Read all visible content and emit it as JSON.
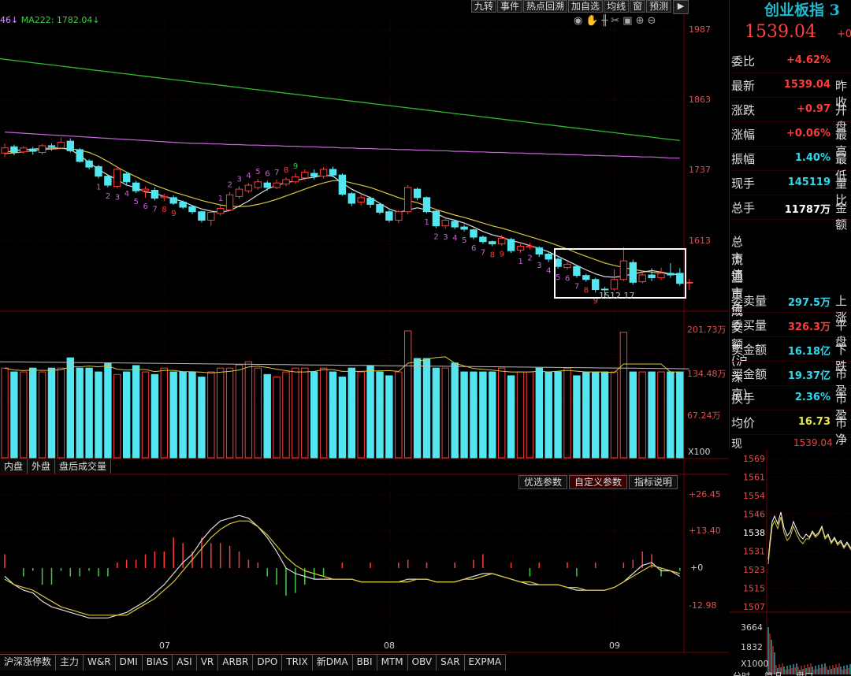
{
  "toolbar": {
    "items": [
      "九转",
      "事件",
      "热点回溯",
      "加自选",
      "均线",
      "窗",
      "预测"
    ]
  },
  "legend": {
    "prefix": "46↓",
    "ma222": "MA222: 1782.04↓"
  },
  "main": {
    "price_ticks": [
      "1987",
      "1863",
      "1737",
      "1613"
    ],
    "box_label": "1512.17",
    "month_labels": [
      "07",
      "08",
      "09"
    ]
  },
  "volume": {
    "ticks": [
      "201.73万",
      "134.48万",
      "67.24万"
    ],
    "unit": "X100",
    "tabs": [
      "内盘",
      "外盘",
      "盘后成交量"
    ]
  },
  "macd": {
    "ticks": [
      "+26.45",
      "+13.40",
      "+0",
      "-12.98"
    ],
    "tabs": [
      "优选参数",
      "自定义参数",
      "指标说明"
    ]
  },
  "bottom_tabs": [
    "沪深涨停数",
    "主力",
    "W&R",
    "DMI",
    "BIAS",
    "ASI",
    "VR",
    "ARBR",
    "DPO",
    "TRIX",
    "新DMA",
    "BBI",
    "MTM",
    "OBV",
    "SAR",
    "EXPMA"
  ],
  "quote": {
    "title": "创业板指 3",
    "price": "1539.04",
    "price_side": "+0",
    "rows": [
      {
        "label": "委比",
        "value": "+4.62%",
        "color": "red",
        "side": ""
      },
      {
        "label": "最新",
        "value": "1539.04",
        "color": "red",
        "side": "昨收"
      },
      {
        "label": "涨跌",
        "value": "+0.97",
        "color": "red",
        "side": "开盘"
      },
      {
        "label": "涨幅",
        "value": "+0.06%",
        "color": "red",
        "side": "最高"
      },
      {
        "label": "振幅",
        "value": "1.40%",
        "color": "cyan",
        "side": "最低"
      },
      {
        "label": "现手",
        "value": "145119",
        "color": "cyan",
        "side": "量比"
      },
      {
        "label": "总手",
        "value": "11787万",
        "color": "white",
        "side": "金额"
      }
    ],
    "stats": [
      "总市值",
      "流通市值",
      "三市成交额(沪深京)"
    ],
    "rows2": [
      {
        "label": "委卖量",
        "value": "297.5万",
        "color": "cyan",
        "side": "上涨"
      },
      {
        "label": "委买量",
        "value": "326.3万",
        "color": "red",
        "side": "平盘"
      },
      {
        "label": "卖金额",
        "value": "16.18亿",
        "color": "cyan",
        "side": "下跌"
      },
      {
        "label": "买金额",
        "value": "19.37亿",
        "color": "cyan",
        "side": "市盈"
      },
      {
        "label": "换手",
        "value": "2.36%",
        "color": "cyan",
        "side": "市盈"
      },
      {
        "label": "均价",
        "value": "16.73",
        "color": "yellow",
        "side": "市净"
      }
    ],
    "now_label": "现价",
    "now_value": "1539.04"
  },
  "mini": {
    "ticks": [
      "1569",
      "1561",
      "1554",
      "1546",
      "1538",
      "1531",
      "1523",
      "1515",
      "1507"
    ],
    "vol_ticks": [
      "3664",
      "1832",
      "X1000"
    ],
    "bottom": [
      "分时",
      "简况",
      "盘口"
    ]
  },
  "chart_data": {
    "type": "candlestick",
    "candles": [
      [
        1769,
        1778,
        1762,
        1786,
        1
      ],
      [
        1780,
        1770,
        1765,
        1784,
        0
      ],
      [
        1771,
        1778,
        1768,
        1781,
        1
      ],
      [
        1776,
        1772,
        1766,
        1780,
        0
      ],
      [
        1770,
        1782,
        1766,
        1785,
        1
      ],
      [
        1782,
        1780,
        1773,
        1786,
        0
      ],
      [
        1778,
        1788,
        1776,
        1796,
        1
      ],
      [
        1790,
        1773,
        1770,
        1795,
        0
      ],
      [
        1775,
        1754,
        1752,
        1778,
        0
      ],
      [
        1755,
        1744,
        1740,
        1758,
        0
      ],
      [
        1745,
        1728,
        1724,
        1748,
        0
      ],
      [
        1728,
        1712,
        1708,
        1731,
        0
      ],
      [
        1710,
        1740,
        1706,
        1744,
        1
      ],
      [
        1732,
        1718,
        1712,
        1736,
        0
      ],
      [
        1716,
        1702,
        1698,
        1720,
        0
      ],
      [
        1702,
        1705,
        1690,
        1710,
        1
      ],
      [
        1703,
        1689,
        1685,
        1708,
        0
      ],
      [
        1690,
        1692,
        1684,
        1697,
        1
      ],
      [
        1690,
        1680,
        1677,
        1694,
        0
      ],
      [
        1682,
        1673,
        1670,
        1685,
        0
      ],
      [
        1674,
        1665,
        1661,
        1677,
        0
      ],
      [
        1665,
        1650,
        1646,
        1667,
        0
      ],
      [
        1650,
        1664,
        1640,
        1668,
        1
      ],
      [
        1662,
        1671,
        1658,
        1676,
        1
      ],
      [
        1668,
        1695,
        1666,
        1700,
        1
      ],
      [
        1692,
        1705,
        1688,
        1710,
        1
      ],
      [
        1702,
        1712,
        1698,
        1716,
        1
      ],
      [
        1708,
        1718,
        1704,
        1723,
        1
      ],
      [
        1716,
        1708,
        1702,
        1720,
        0
      ],
      [
        1708,
        1716,
        1705,
        1722,
        1
      ],
      [
        1714,
        1722,
        1710,
        1726,
        1
      ],
      [
        1718,
        1727,
        1714,
        1733,
        1
      ],
      [
        1725,
        1735,
        1720,
        1740,
        1
      ],
      [
        1733,
        1728,
        1722,
        1740,
        0
      ],
      [
        1728,
        1740,
        1724,
        1744,
        1
      ],
      [
        1740,
        1730,
        1726,
        1745,
        0
      ],
      [
        1730,
        1696,
        1693,
        1733,
        0
      ],
      [
        1697,
        1680,
        1675,
        1700,
        0
      ],
      [
        1682,
        1690,
        1676,
        1694,
        1
      ],
      [
        1689,
        1678,
        1672,
        1692,
        0
      ],
      [
        1678,
        1664,
        1660,
        1681,
        0
      ],
      [
        1665,
        1650,
        1646,
        1668,
        0
      ],
      [
        1650,
        1665,
        1645,
        1668,
        1
      ],
      [
        1665,
        1708,
        1660,
        1712,
        1
      ],
      [
        1705,
        1690,
        1685,
        1708,
        0
      ],
      [
        1690,
        1665,
        1662,
        1692,
        0
      ],
      [
        1666,
        1640,
        1636,
        1668,
        0
      ],
      [
        1640,
        1650,
        1635,
        1654,
        1
      ],
      [
        1648,
        1638,
        1634,
        1651,
        0
      ],
      [
        1638,
        1634,
        1630,
        1642,
        0
      ],
      [
        1633,
        1620,
        1616,
        1635,
        0
      ],
      [
        1620,
        1612,
        1608,
        1623,
        0
      ],
      [
        1612,
        1608,
        1604,
        1614,
        0
      ],
      [
        1608,
        1618,
        1605,
        1624,
        1
      ],
      [
        1616,
        1596,
        1592,
        1619,
        0
      ],
      [
        1597,
        1604,
        1592,
        1608,
        1
      ],
      [
        1604,
        1602,
        1598,
        1610,
        1
      ],
      [
        1601,
        1590,
        1585,
        1604,
        0
      ],
      [
        1590,
        1581,
        1576,
        1593,
        0
      ],
      [
        1581,
        1568,
        1564,
        1584,
        0
      ],
      [
        1566,
        1572,
        1562,
        1576,
        1
      ],
      [
        1568,
        1552,
        1548,
        1570,
        0
      ],
      [
        1552,
        1545,
        1541,
        1555,
        0
      ],
      [
        1545,
        1527,
        1522,
        1548,
        0
      ],
      [
        1528,
        1528,
        1512,
        1532,
        0
      ],
      [
        1528,
        1545,
        1525,
        1563,
        1
      ],
      [
        1545,
        1578,
        1542,
        1602,
        1
      ],
      [
        1575,
        1540,
        1536,
        1580,
        0
      ],
      [
        1541,
        1553,
        1538,
        1560,
        1
      ],
      [
        1553,
        1548,
        1542,
        1565,
        0
      ],
      [
        1548,
        1556,
        1544,
        1566,
        1
      ],
      [
        1556,
        1553,
        1548,
        1574,
        0
      ],
      [
        1556,
        1538,
        1534,
        1565,
        0
      ],
      [
        1540,
        1539,
        1527,
        1546,
        1
      ]
    ],
    "ma5": [
      1770,
      1773,
      1775,
      1776,
      1777,
      1778,
      1778,
      1775,
      1765,
      1752,
      1740,
      1730,
      1722,
      1712,
      1708,
      1700,
      1698,
      1692,
      1688,
      1683,
      1676,
      1670,
      1666,
      1664,
      1667,
      1675,
      1684,
      1695,
      1705,
      1712,
      1716,
      1720,
      1724,
      1726,
      1730,
      1728,
      1716,
      1705,
      1697,
      1690,
      1680,
      1670,
      1664,
      1668,
      1672,
      1668,
      1662,
      1654,
      1650,
      1645,
      1638,
      1630,
      1624,
      1620,
      1614,
      1610,
      1605,
      1600,
      1594,
      1586,
      1578,
      1570,
      1562,
      1555,
      1550,
      1549,
      1551,
      1555,
      1558,
      1561,
      1558,
      1555,
      1553
    ],
    "ma10": [
      1768,
      1769,
      1771,
      1773,
      1775,
      1776,
      1777,
      1777,
      1774,
      1770,
      1763,
      1754,
      1744,
      1735,
      1727,
      1719,
      1712,
      1706,
      1700,
      1695,
      1690,
      1685,
      1681,
      1677,
      1675,
      1674,
      1675,
      1678,
      1682,
      1687,
      1693,
      1699,
      1705,
      1711,
      1716,
      1720,
      1720,
      1716,
      1712,
      1708,
      1702,
      1696,
      1690,
      1685,
      1681,
      1675,
      1669,
      1664,
      1659,
      1655,
      1650,
      1645,
      1640,
      1636,
      1631,
      1626,
      1621,
      1616,
      1611,
      1605,
      1599,
      1592,
      1586,
      1580,
      1574,
      1570,
      1566,
      1563,
      1560,
      1558,
      1556,
      1555,
      1554
    ],
    "ma60": [
      1806,
      1805,
      1804,
      1803,
      1802,
      1801,
      1800,
      1799,
      1798,
      1797,
      1796,
      1795,
      1794,
      1793,
      1792,
      1791,
      1790,
      1789,
      1788,
      1787,
      1786,
      1786,
      1785,
      1785,
      1784,
      1784,
      1783,
      1783,
      1782,
      1782,
      1781,
      1781,
      1780,
      1780,
      1779,
      1779,
      1778,
      1778,
      1777,
      1777,
      1776,
      1776,
      1775,
      1775,
      1774,
      1774,
      1773,
      1773,
      1772,
      1772,
      1771,
      1771,
      1770,
      1770,
      1769,
      1769,
      1768,
      1768,
      1767,
      1767,
      1766,
      1766,
      1765,
      1765,
      1764,
      1764,
      1763,
      1763,
      1762,
      1762,
      1761,
      1760,
      1760
    ],
    "ma222": [
      1935,
      1933,
      1931,
      1929,
      1927,
      1925,
      1923,
      1921,
      1919,
      1917,
      1915,
      1913,
      1911,
      1909,
      1907,
      1905,
      1903,
      1901,
      1899,
      1897,
      1895,
      1893,
      1891,
      1889,
      1887,
      1885,
      1883,
      1881,
      1879,
      1877,
      1875,
      1873,
      1871,
      1869,
      1867,
      1865,
      1863,
      1861,
      1859,
      1857,
      1855,
      1853,
      1851,
      1849,
      1847,
      1845,
      1843,
      1841,
      1839,
      1837,
      1835,
      1833,
      1831,
      1829,
      1827,
      1825,
      1823,
      1821,
      1819,
      1817,
      1815,
      1813,
      1811,
      1809,
      1807,
      1805,
      1803,
      1801,
      1799,
      1797,
      1795,
      1793,
      1791
    ],
    "volumes": [
      140,
      134,
      134,
      140,
      134,
      140,
      140,
      156,
      140,
      140,
      134,
      147,
      130,
      134,
      144,
      134,
      130,
      140,
      134,
      134,
      134,
      126,
      134,
      140,
      140,
      145,
      150,
      140,
      130,
      126,
      134,
      140,
      140,
      134,
      140,
      134,
      126,
      140,
      134,
      144,
      134,
      128,
      134,
      198,
      155,
      155,
      140,
      140,
      148,
      134,
      134,
      134,
      134,
      140,
      128,
      134,
      134,
      140,
      134,
      134,
      140,
      128,
      134,
      134,
      134,
      134,
      196,
      134,
      134,
      134,
      134,
      134,
      134
    ],
    "macd_dif": [
      -3,
      -6,
      -8,
      -9,
      -12,
      -14,
      -15,
      -16,
      -17,
      -18,
      -18,
      -18,
      -17,
      -16,
      -14,
      -12,
      -9,
      -6,
      -2,
      2,
      5,
      10,
      14,
      17,
      18,
      19,
      18,
      15,
      11,
      6,
      0,
      -2,
      -3,
      -4,
      -4,
      -4,
      -4,
      -4,
      -5,
      -5,
      -5,
      -5,
      -5,
      -4,
      -4,
      -4,
      -5,
      -5,
      -5,
      -4,
      -3,
      -2,
      -2,
      -3,
      -4,
      -5,
      -6,
      -6,
      -6,
      -6,
      -7,
      -8,
      -8,
      -8,
      -8,
      -7,
      -5,
      -2,
      1,
      2,
      -1,
      -1,
      -3
    ],
    "macd_dea": [
      -4,
      -6,
      -7,
      -8,
      -10,
      -12,
      -14,
      -15,
      -16,
      -17,
      -17,
      -17,
      -17,
      -17,
      -15,
      -13,
      -11,
      -8,
      -5,
      -1,
      3,
      7,
      11,
      14,
      16,
      17,
      17,
      15,
      12,
      8,
      4,
      1,
      -1,
      -2,
      -3,
      -4,
      -4,
      -4,
      -5,
      -5,
      -5,
      -5,
      -5,
      -5,
      -4,
      -4,
      -5,
      -5,
      -5,
      -4,
      -4,
      -3,
      -2,
      -3,
      -4,
      -5,
      -5,
      -6,
      -6,
      -6,
      -7,
      -7,
      -8,
      -8,
      -8,
      -7,
      -5,
      -3,
      -1,
      1,
      0,
      -1,
      -2
    ],
    "box_range": {
      "start_index": 60,
      "end_index": 72
    }
  }
}
